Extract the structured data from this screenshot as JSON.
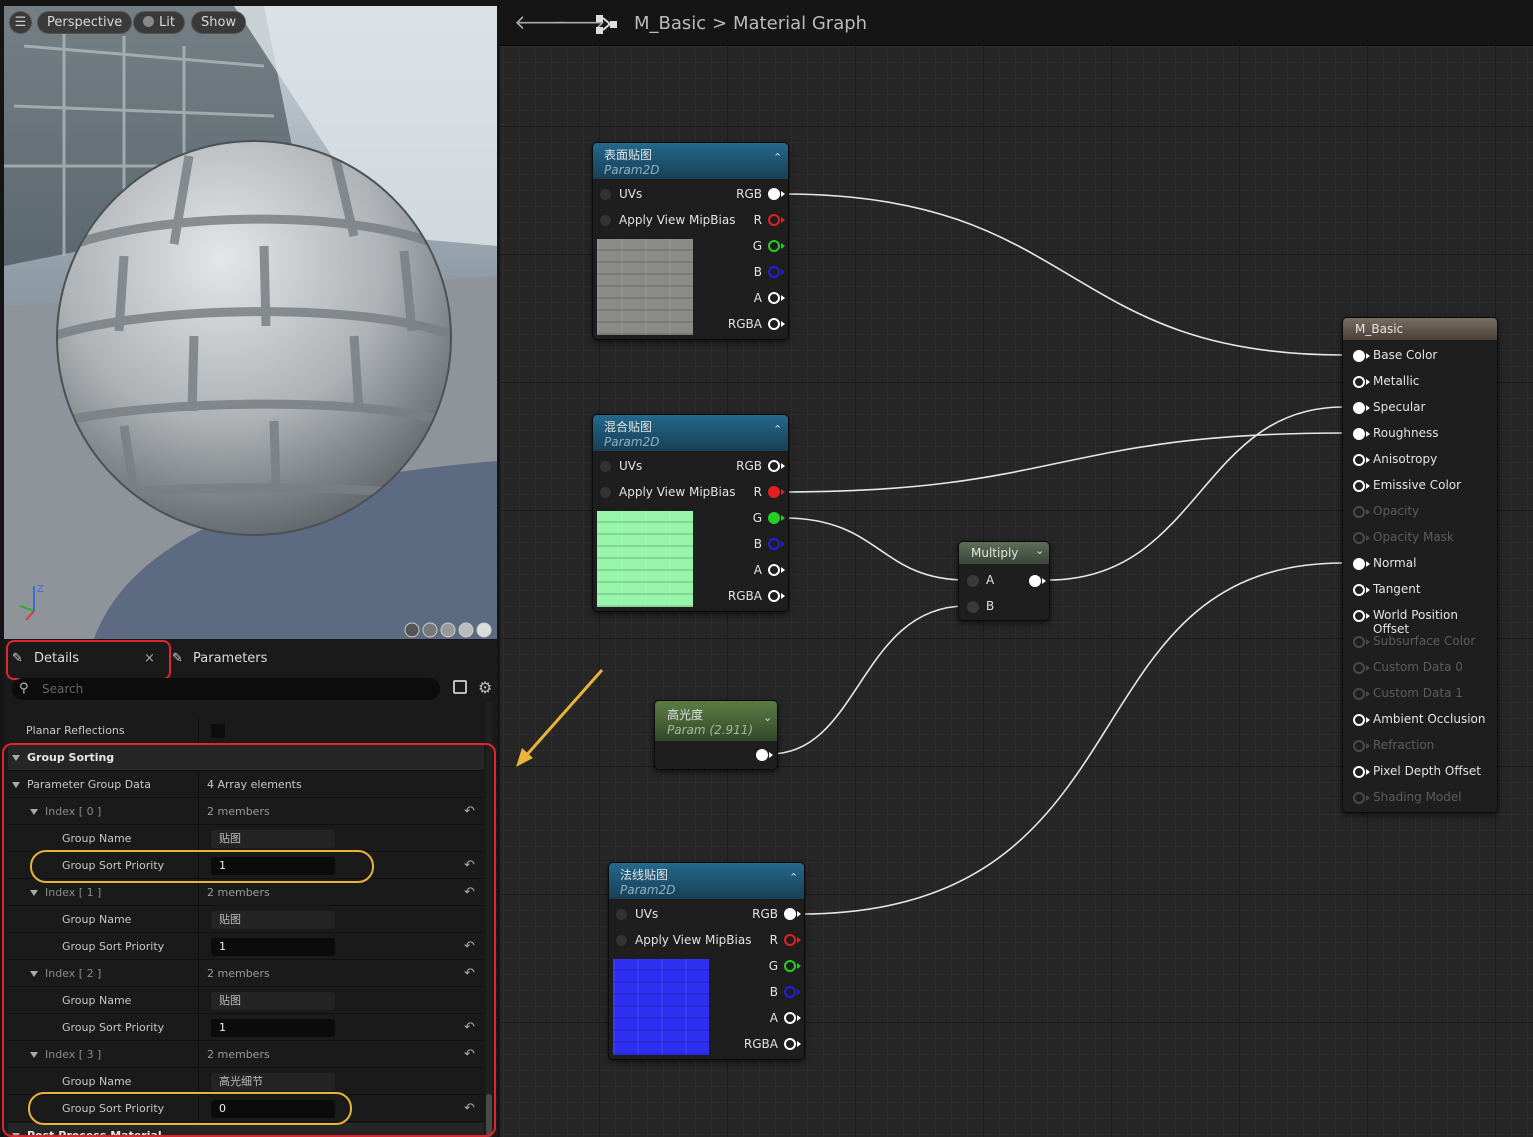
{
  "viewport": {
    "menu_icon": "menu-icon",
    "perspective_label": "Perspective",
    "lit_label": "Lit",
    "show_label": "Show"
  },
  "tabs": {
    "details_label": "Details",
    "close_glyph": "×",
    "parameters_label": "Parameters"
  },
  "search": {
    "placeholder": "Search"
  },
  "details": {
    "planar_reflections": "Planar Reflections",
    "group_sorting": "Group Sorting",
    "parameter_group_data": "Parameter Group Data",
    "array_count": "4 Array elements",
    "group_name_label": "Group Name",
    "group_sort_priority_label": "Group Sort Priority",
    "post_process_material": "Post Process Material",
    "entries": [
      {
        "index": "Index [ 0 ]",
        "members": "2 members",
        "group_name": "贴图",
        "priority": "1"
      },
      {
        "index": "Index [ 1 ]",
        "members": "2 members",
        "group_name": "贴图",
        "priority": "1"
      },
      {
        "index": "Index [ 2 ]",
        "members": "2 members",
        "group_name": "贴图",
        "priority": "1"
      },
      {
        "index": "Index [ 3 ]",
        "members": "2 members",
        "group_name": "高光细节",
        "priority": "0"
      }
    ]
  },
  "graph": {
    "asset_name": "M_Basic",
    "breadcrumb_sep": ">",
    "title": "Material Graph",
    "texture_nodes": [
      {
        "title": "表面贴图",
        "subtitle": "Param2D",
        "in_uvs": "UVs",
        "in_mip": "Apply View MipBias",
        "out": [
          "RGB",
          "R",
          "G",
          "B",
          "A",
          "RGBA"
        ],
        "swatch": "#8a8a86"
      },
      {
        "title": "混合贴图",
        "subtitle": "Param2D",
        "in_uvs": "UVs",
        "in_mip": "Apply View MipBias",
        "out": [
          "RGB",
          "R",
          "G",
          "B",
          "A",
          "RGBA"
        ],
        "swatch": "#96f5a8"
      },
      {
        "title": "法线贴图",
        "subtitle": "Param2D",
        "in_uvs": "UVs",
        "in_mip": "Apply View MipBias",
        "out": [
          "RGB",
          "R",
          "G",
          "B",
          "A",
          "RGBA"
        ],
        "swatch": "#2f2ff2"
      }
    ],
    "scalar_node": {
      "title": "高光度",
      "subtitle": "Param (2.911)"
    },
    "multiply_node": {
      "title": "Multiply",
      "in_a": "A",
      "in_b": "B"
    },
    "result_node": {
      "title": "M_Basic",
      "pins": [
        {
          "label": "Base Color",
          "state": "connected"
        },
        {
          "label": "Metallic",
          "state": "active"
        },
        {
          "label": "Specular",
          "state": "connected"
        },
        {
          "label": "Roughness",
          "state": "connected"
        },
        {
          "label": "Anisotropy",
          "state": "active"
        },
        {
          "label": "Emissive Color",
          "state": "active"
        },
        {
          "label": "Opacity",
          "state": "disabled"
        },
        {
          "label": "Opacity Mask",
          "state": "disabled"
        },
        {
          "label": "Normal",
          "state": "connected"
        },
        {
          "label": "Tangent",
          "state": "active"
        },
        {
          "label": "World Position Offset",
          "state": "active"
        },
        {
          "label": "Subsurface Color",
          "state": "disabled"
        },
        {
          "label": "Custom Data 0",
          "state": "disabled"
        },
        {
          "label": "Custom Data 1",
          "state": "disabled"
        },
        {
          "label": "Ambient Occlusion",
          "state": "active"
        },
        {
          "label": "Refraction",
          "state": "disabled"
        },
        {
          "label": "Pixel Depth Offset",
          "state": "active"
        },
        {
          "label": "Shading Model",
          "state": "disabled"
        }
      ]
    }
  },
  "colors": {
    "highlight_red": "#e0252d",
    "highlight_yellow": "#e8b43a",
    "pin_red": "#e61e1e",
    "pin_green": "#22d022",
    "pin_blue": "#1e1ee6",
    "texture_header": "#1e5a7a",
    "scalar_header": "#4f6f3a",
    "result_header": "#6a5d52"
  }
}
